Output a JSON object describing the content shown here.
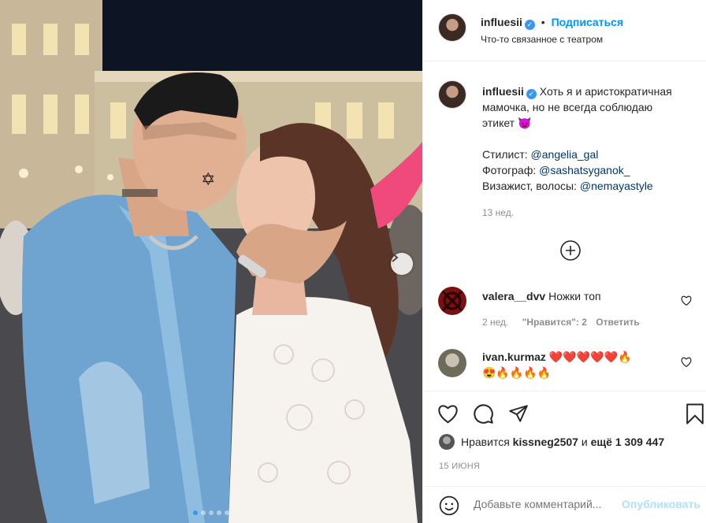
{
  "post": {
    "author": "influesii",
    "follow_label": "Подписаться",
    "separator": "•",
    "location": "Что-то связанное с театром",
    "caption_line1": "Хоть я и аристократичная",
    "caption_line2": "мамочка, но не всегда соблюдаю",
    "caption_line3": "этикет",
    "caption_emoji": "😈",
    "stylist_label": "Стилист:",
    "stylist": "@angelia_gal",
    "photographer_label": "Фотограф:",
    "photographer": "@sashatsyganok_",
    "makeup_label": "Визажист, волосы:",
    "makeup": "@nemayastyle",
    "age": "13 нед.",
    "verified_mark": "✓"
  },
  "comments": [
    {
      "user": "valera__dvv",
      "text": "Ножки топ",
      "age": "2 нед.",
      "likes_label": "\"Нравится\": 2",
      "reply_label": "Ответить"
    },
    {
      "user": "ivan.kurmaz",
      "text_line1": "❤️❤️❤️❤️❤️🔥",
      "text_line2": "😍🔥🔥🔥🔥"
    }
  ],
  "likes": {
    "prefix": "Нравится",
    "user": "kissneg2507",
    "middle": "и",
    "count": "ещё 1 309 447"
  },
  "date": "15 ИЮНЯ",
  "comment_box": {
    "placeholder": "Добавьте комментарий...",
    "publish_label": "Опубликовать"
  },
  "carousel": {
    "slides": 5,
    "active": 0
  },
  "colors": {
    "accent": "#0095f6",
    "verified": "#3897f0",
    "publish_disabled": "#b2dffc"
  },
  "icons": [
    "heart-icon",
    "comment-icon",
    "share-icon",
    "bookmark-icon",
    "add-circle-icon",
    "chevron-right-icon",
    "smile-icon"
  ]
}
